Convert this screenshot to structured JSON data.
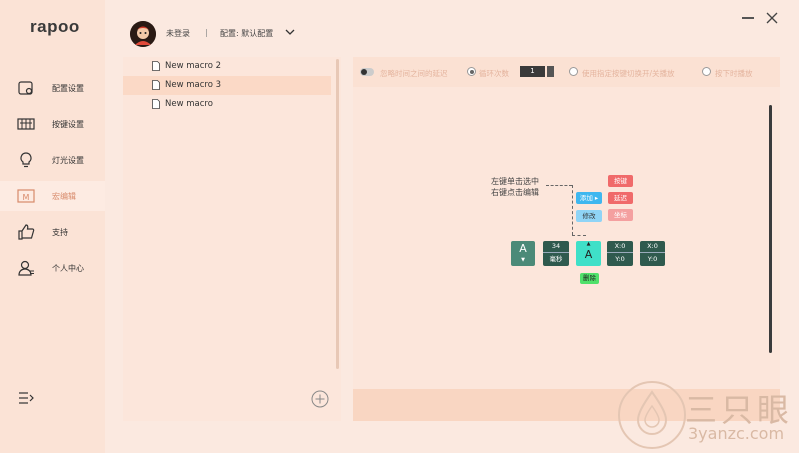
{
  "app": {
    "logo": "rapoo"
  },
  "header": {
    "user_name": "未登录",
    "separator": "|",
    "profile_label": "配置: 默认配置"
  },
  "sidebar": {
    "items": [
      {
        "label": "配置设置",
        "icon": "config-icon",
        "active": false
      },
      {
        "label": "按键设置",
        "icon": "keyboard-icon",
        "active": false
      },
      {
        "label": "灯光设置",
        "icon": "lightbulb-icon",
        "active": false
      },
      {
        "label": "宏编辑",
        "icon": "macro-icon",
        "active": true
      },
      {
        "label": "支持",
        "icon": "thumbs-up-icon",
        "active": false
      },
      {
        "label": "个人中心",
        "icon": "user-icon",
        "active": false
      }
    ]
  },
  "macros": {
    "items": [
      {
        "name": "New macro 2",
        "selected": false
      },
      {
        "name": "New macro 3",
        "selected": true
      },
      {
        "name": "New macro",
        "selected": false
      }
    ]
  },
  "toolbar": {
    "ignore_delay_label": "忽略时间之间的延迟",
    "loop_label": "循环次数",
    "loop_count": "1",
    "toggle_label": "使用指定按键切换开/关播放",
    "hold_label": "按下时播放"
  },
  "tutorial": {
    "hint_line1": "左键单击选中",
    "hint_line2": "右键点击编辑",
    "add_label": "添加 ▸",
    "edit_label": "修改",
    "key_label": "按键",
    "delay_label": "延迟",
    "coord_label": "坐标",
    "delete_label": "删除",
    "block1_key": "A",
    "block2_value": "34",
    "block2_unit": "毫秒",
    "block3_key": "A",
    "block4_x": "X:0",
    "block4_y": "Y:0",
    "block5_x": "X:0",
    "block5_y": "Y:0"
  },
  "watermark": {
    "title": "三只眼",
    "url": "3yanzc.com"
  },
  "colors": {
    "accent": "#d88a6a",
    "sidebar_bg": "#fbe3d6",
    "panel_bg": "#fce6db"
  }
}
